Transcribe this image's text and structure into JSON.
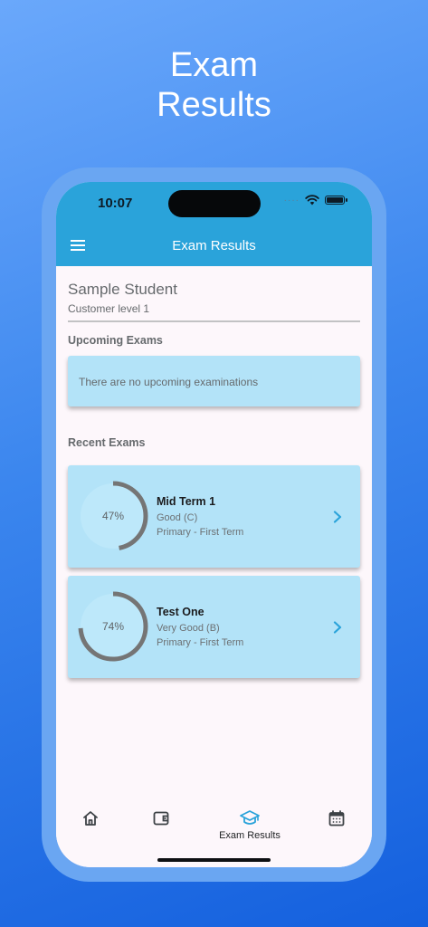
{
  "promo": {
    "title_line1": "Exam",
    "title_line2": "Results"
  },
  "status_bar": {
    "time": "10:07",
    "signal": "····"
  },
  "app_bar": {
    "title": "Exam Results",
    "menu_icon": "hamburger-icon"
  },
  "student": {
    "name": "Sample Student",
    "level": "Customer level 1"
  },
  "upcoming": {
    "title": "Upcoming Exams",
    "empty_text": "There are no upcoming examinations"
  },
  "recent": {
    "title": "Recent Exams",
    "exams": [
      {
        "name": "Mid Term 1",
        "grade": "Good (C)",
        "term": "Primary - First Term",
        "percent_label": "47%",
        "percent": 47
      },
      {
        "name": "Test One",
        "grade": "Very Good (B)",
        "term": "Primary - First Term",
        "percent_label": "74%",
        "percent": 74
      }
    ]
  },
  "bottom_nav": {
    "items": [
      {
        "icon": "home-icon",
        "label": ""
      },
      {
        "icon": "wallet-icon",
        "label": ""
      },
      {
        "icon": "graduation-cap-icon",
        "label": "Exam Results"
      },
      {
        "icon": "calendar-icon",
        "label": ""
      }
    ],
    "active_index": 2
  },
  "colors": {
    "header": "#2aa3da",
    "card": "#b3e3f8",
    "ring": "#757575",
    "accent": "#2aa3da"
  }
}
